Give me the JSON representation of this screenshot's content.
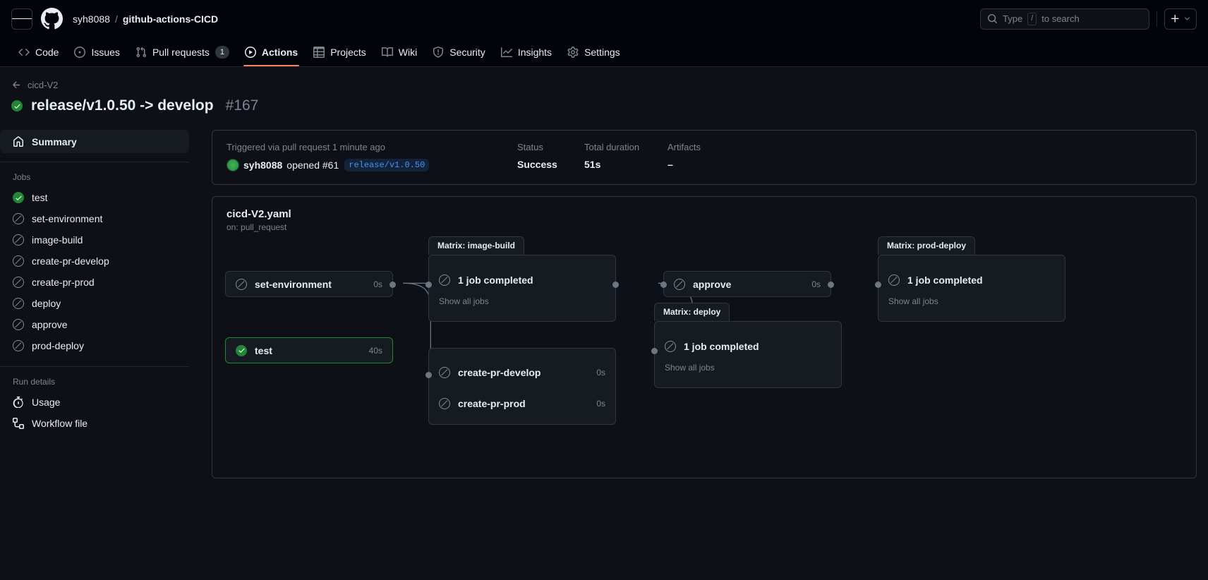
{
  "header": {
    "menu_label": "Open menu",
    "logo_name": "github-logo",
    "owner": "syh8088",
    "separator": "/",
    "repo": "github-actions-CICD",
    "search": {
      "placeholder": "Type / to search",
      "key_hint": "/",
      "prefix": "Type",
      "suffix": "to search"
    },
    "create_label": "+"
  },
  "nav": {
    "tabs": [
      {
        "label": "Code",
        "icon": "code-icon",
        "active": false,
        "count": null
      },
      {
        "label": "Issues",
        "icon": "issue-opened-icon",
        "active": false,
        "count": null
      },
      {
        "label": "Pull requests",
        "icon": "git-pull-request-icon",
        "active": false,
        "count": "1"
      },
      {
        "label": "Actions",
        "icon": "play-icon",
        "active": true,
        "count": null
      },
      {
        "label": "Projects",
        "icon": "table-icon",
        "active": false,
        "count": null
      },
      {
        "label": "Wiki",
        "icon": "book-icon",
        "active": false,
        "count": null
      },
      {
        "label": "Security",
        "icon": "shield-icon",
        "active": false,
        "count": null
      },
      {
        "label": "Insights",
        "icon": "graph-icon",
        "active": false,
        "count": null
      },
      {
        "label": "Settings",
        "icon": "gear-icon",
        "active": false,
        "count": null
      }
    ]
  },
  "run": {
    "back_label": "cicd-V2",
    "title": "release/v1.0.50 -> develop",
    "number": "#167",
    "status_icon": "success-check-icon"
  },
  "sidebar": {
    "summary_label": "Summary",
    "jobs_heading": "Jobs",
    "jobs": [
      {
        "label": "test",
        "status": "success"
      },
      {
        "label": "set-environment",
        "status": "skipped"
      },
      {
        "label": "image-build",
        "status": "skipped"
      },
      {
        "label": "create-pr-develop",
        "status": "skipped"
      },
      {
        "label": "create-pr-prod",
        "status": "skipped"
      },
      {
        "label": "deploy",
        "status": "skipped"
      },
      {
        "label": "approve",
        "status": "skipped"
      },
      {
        "label": "prod-deploy",
        "status": "skipped"
      }
    ],
    "run_details_heading": "Run details",
    "run_details": [
      {
        "label": "Usage",
        "icon": "stopwatch-icon"
      },
      {
        "label": "Workflow file",
        "icon": "workflow-file-icon"
      }
    ]
  },
  "summary": {
    "trigger_label": "Triggered via pull request 1 minute ago",
    "actor": "syh8088",
    "action_text": "opened #61",
    "branch": "release/v1.0.50",
    "status_label": "Status",
    "status_value": "Success",
    "duration_label": "Total duration",
    "duration_value": "51s",
    "artifacts_label": "Artifacts",
    "artifacts_value": "–"
  },
  "graph": {
    "file": "cicd-V2.yaml",
    "trigger": "on: pull_request",
    "nodes": {
      "set_environment": {
        "label": "set-environment",
        "duration": "0s",
        "status": "skipped"
      },
      "test": {
        "label": "test",
        "duration": "40s",
        "status": "success"
      },
      "approve": {
        "label": "approve",
        "duration": "0s",
        "status": "skipped"
      },
      "create_pr_develop": {
        "label": "create-pr-develop",
        "duration": "0s",
        "status": "skipped"
      },
      "create_pr_prod": {
        "label": "create-pr-prod",
        "duration": "0s",
        "status": "skipped"
      }
    },
    "matrices": {
      "image_build": {
        "tab": "Matrix: image-build",
        "summary": "1 job completed",
        "link": "Show all jobs",
        "status": "skipped"
      },
      "deploy": {
        "tab": "Matrix: deploy",
        "summary": "1 job completed",
        "link": "Show all jobs",
        "status": "skipped"
      },
      "prod_deploy": {
        "tab": "Matrix: prod-deploy",
        "summary": "1 job completed",
        "link": "Show all jobs",
        "status": "skipped"
      }
    }
  },
  "colors": {
    "accent": "#1f6feb",
    "success": "#238636",
    "active_tab": "#f78166",
    "muted": "#7d8590"
  }
}
